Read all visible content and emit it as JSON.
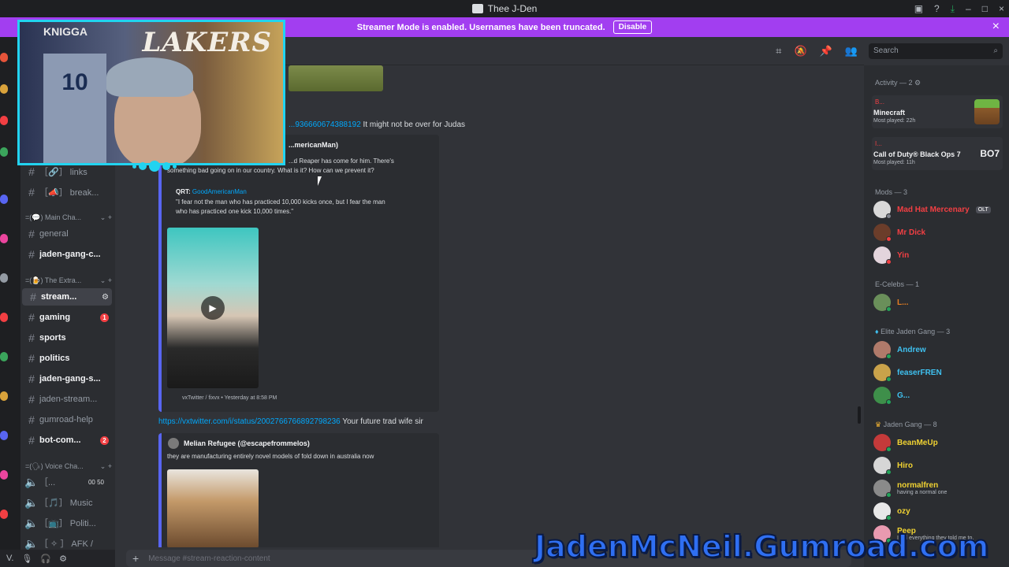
{
  "window": {
    "title": "Thee J-Den"
  },
  "banner": {
    "text": "Streamer Mode is enabled. Usernames have been truncated.",
    "disable_label": "Disable",
    "close_icon": "×"
  },
  "search": {
    "placeholder": "Search"
  },
  "channels": {
    "items": [
      {
        "label": "［🔗］ links"
      },
      {
        "label": "［📣］ break..."
      },
      {
        "category": "=(💬) Main Cha..."
      },
      {
        "label": "general"
      },
      {
        "label": "jaden-gang-c..."
      },
      {
        "category": "=(🍺) The Extra..."
      },
      {
        "label": "stream..."
      },
      {
        "label": "gaming",
        "badge": "1"
      },
      {
        "label": "sports"
      },
      {
        "label": "politics"
      },
      {
        "label": "jaden-gang-s..."
      },
      {
        "label": "jaden-stream..."
      },
      {
        "label": "gumroad-help"
      },
      {
        "label": "bot-com...",
        "badge": "2"
      },
      {
        "category": "=(🗣) Voice Cha..."
      },
      {
        "label": "［...",
        "extra": "00  50"
      },
      {
        "label": "［🎵］ Music"
      },
      {
        "label": "［📺］ Politi..."
      },
      {
        "label": "［ ✧ ］ AFK /"
      }
    ]
  },
  "user_panel": {
    "name": "V."
  },
  "messages": {
    "m1_link": "...936660674388192",
    "m1_text": " It might not be over for Judas",
    "e1_author": "...mericanMan)",
    "e1_body1": "...d Reaper has come for him. There's",
    "e1_body2": "something bad going on in our country. What is it? How can we prevent it?",
    "e1_qrt_label": "QRT: ",
    "e1_qrt_name": "GoodAmericanMan",
    "e1_quote1": "\"I fear not the man who has practiced 10,000 kicks once, but I fear the man",
    "e1_quote2": "who has practiced one kick 10,000 times.\"",
    "e1_footer": "vxTwitter / fixvx • Yesterday at 8:58 PM",
    "m2_link": "https://vxtwitter.com/i/status/2002766766892798236",
    "m2_text": " Your future trad wife sir",
    "e2_author": "Melian Refugee (@escapefrommelos)",
    "e2_body": "they are manufacturing entirely novel models of fold down in australia now"
  },
  "composer": {
    "placeholder": "Message #stream-reaction-content"
  },
  "members": {
    "activity_header": "Activity — 2",
    "activities": [
      {
        "user": "B...",
        "game": "Minecraft",
        "played": "Most played: 22h"
      },
      {
        "user": "I...",
        "game": "Call of Duty® Black Ops 7",
        "played": "Most played: 11h",
        "logo": "BO7"
      }
    ],
    "mods_header": "Mods — 3",
    "mods": [
      {
        "name": "Mad Hat Mercenary",
        "tag": "OLT"
      },
      {
        "name": "Mr Dick"
      },
      {
        "name": "Yin"
      }
    ],
    "ecelebs_header": "E-Celebs — 1",
    "ecelebs": [
      {
        "name": "L..."
      }
    ],
    "elite_header": "Elite Jaden Gang — 3",
    "elite": [
      {
        "name": "Andrew"
      },
      {
        "name": "feaserFREN"
      },
      {
        "name": "G..."
      }
    ],
    "gang_header": "Jaden Gang — 8",
    "gang": [
      {
        "name": "BeanMeUp"
      },
      {
        "name": "Hiro"
      },
      {
        "name": "normalfren",
        "sub": "having a normal one"
      },
      {
        "name": "ozy"
      },
      {
        "name": "Peep",
        "sub": "I did everything they told me to."
      }
    ]
  },
  "overlay": {
    "webcam_jersey_text": "KNIGGA",
    "webcam_number": "10",
    "webcam_banner": "LAKERS",
    "gumroad_text": "JadenMcNeil.Gumroad.com"
  }
}
